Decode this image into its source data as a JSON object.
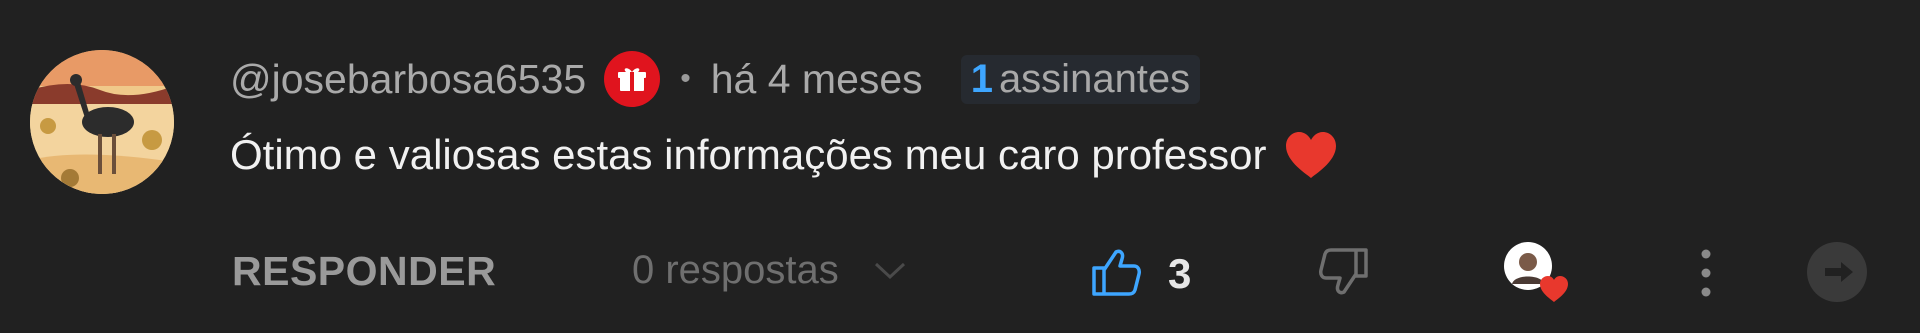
{
  "comment": {
    "author_handle": "@josebarbosa6535",
    "badge_icon": "gift-icon",
    "separator": "•",
    "timestamp": "há 4 meses",
    "subscribers": {
      "count": "1",
      "label": "assinantes"
    },
    "text": "Ótimo e valiosas estas informações meu caro professor",
    "emoji": "heart-emoji"
  },
  "actions": {
    "reply_label": "RESPONDER",
    "replies_label": "0 respostas",
    "like_count": "3",
    "creator_heart": "creator-heart",
    "more": "more-vert-icon",
    "share": "share-icon"
  },
  "colors": {
    "background": "#212121",
    "accent_blue": "#3ea6ff",
    "badge_red": "#e0141e",
    "heart_red": "#e8382d"
  }
}
